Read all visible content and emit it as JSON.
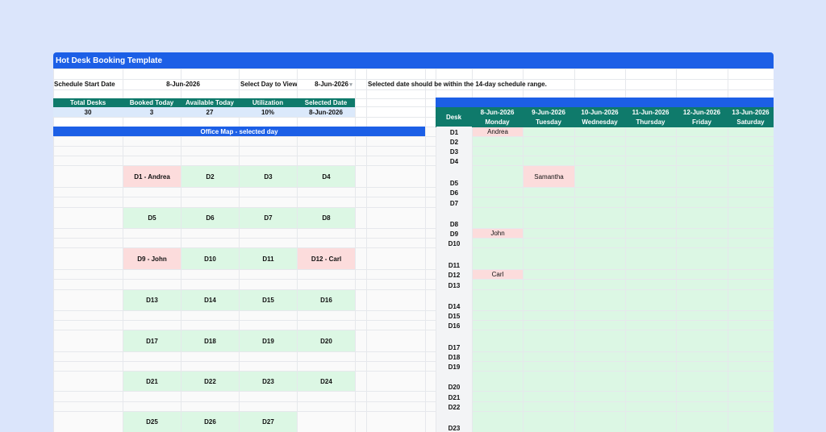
{
  "title": "Hot Desk Booking Template",
  "settings": {
    "start_label": "Schedule Start Date",
    "start_value": "8-Jun-2026",
    "day_label": "Select Day to View",
    "day_value": "8-Jun-2026",
    "note": "Selected date should be within the 14-day schedule range."
  },
  "stats": {
    "headers": [
      "Total Desks",
      "Booked Today",
      "Available Today",
      "Utilization",
      "Selected Date"
    ],
    "values": [
      "30",
      "3",
      "27",
      "10%",
      "8-Jun-2026"
    ]
  },
  "office_map": {
    "title": "Office Map - selected day",
    "rows": [
      [
        {
          "label": "D1 - Andrea",
          "booked": true
        },
        {
          "label": "D2",
          "booked": false
        },
        {
          "label": "D3",
          "booked": false
        },
        {
          "label": "D4",
          "booked": false
        }
      ],
      [
        {
          "label": "D5",
          "booked": false
        },
        {
          "label": "D6",
          "booked": false
        },
        {
          "label": "D7",
          "booked": false
        },
        {
          "label": "D8",
          "booked": false
        }
      ],
      [
        {
          "label": "D9 - John",
          "booked": true
        },
        {
          "label": "D10",
          "booked": false
        },
        {
          "label": "D11",
          "booked": false
        },
        {
          "label": "D12 - Carl",
          "booked": true
        }
      ],
      [
        {
          "label": "D13",
          "booked": false
        },
        {
          "label": "D14",
          "booked": false
        },
        {
          "label": "D15",
          "booked": false
        },
        {
          "label": "D16",
          "booked": false
        }
      ],
      [
        {
          "label": "D17",
          "booked": false
        },
        {
          "label": "D18",
          "booked": false
        },
        {
          "label": "D19",
          "booked": false
        },
        {
          "label": "D20",
          "booked": false
        }
      ],
      [
        {
          "label": "D21",
          "booked": false
        },
        {
          "label": "D22",
          "booked": false
        },
        {
          "label": "D23",
          "booked": false
        },
        {
          "label": "D24",
          "booked": false
        }
      ],
      [
        {
          "label": "D25",
          "booked": false
        },
        {
          "label": "D26",
          "booked": false
        },
        {
          "label": "D27",
          "booked": false
        }
      ]
    ]
  },
  "schedule": {
    "desk_header": "Desk",
    "days": [
      {
        "date": "8-Jun-2026",
        "weekday": "Monday"
      },
      {
        "date": "9-Jun-2026",
        "weekday": "Tuesday"
      },
      {
        "date": "10-Jun-2026",
        "weekday": "Wednesday"
      },
      {
        "date": "11-Jun-2026",
        "weekday": "Thursday"
      },
      {
        "date": "12-Jun-2026",
        "weekday": "Friday"
      },
      {
        "date": "13-Jun-2026",
        "weekday": "Saturday"
      }
    ],
    "desks": [
      {
        "desk": "D1",
        "bookings": [
          "Andrea",
          "",
          "",
          "",
          "",
          ""
        ]
      },
      {
        "desk": "D2",
        "bookings": [
          "",
          "",
          "",
          "",
          "",
          ""
        ]
      },
      {
        "desk": "D3",
        "bookings": [
          "",
          "",
          "",
          "",
          "",
          ""
        ]
      },
      {
        "desk": "D4",
        "bookings": [
          "",
          "",
          "",
          "",
          "",
          ""
        ]
      },
      {
        "desk": "D5",
        "bookings": [
          "",
          "Samantha",
          "",
          "",
          "",
          ""
        ]
      },
      {
        "desk": "D6",
        "bookings": [
          "",
          "",
          "",
          "",
          "",
          ""
        ]
      },
      {
        "desk": "D7",
        "bookings": [
          "",
          "",
          "",
          "",
          "",
          ""
        ]
      },
      {
        "desk": "D8",
        "bookings": [
          "",
          "",
          "",
          "",
          "",
          ""
        ]
      },
      {
        "desk": "D9",
        "bookings": [
          "John",
          "",
          "",
          "",
          "",
          ""
        ]
      },
      {
        "desk": "D10",
        "bookings": [
          "",
          "",
          "",
          "",
          "",
          ""
        ]
      },
      {
        "desk": "D11",
        "bookings": [
          "",
          "",
          "",
          "",
          "",
          ""
        ]
      },
      {
        "desk": "D12",
        "bookings": [
          "Carl",
          "",
          "",
          "",
          "",
          ""
        ]
      },
      {
        "desk": "D13",
        "bookings": [
          "",
          "",
          "",
          "",
          "",
          ""
        ]
      },
      {
        "desk": "D14",
        "bookings": [
          "",
          "",
          "",
          "",
          "",
          ""
        ]
      },
      {
        "desk": "D15",
        "bookings": [
          "",
          "",
          "",
          "",
          "",
          ""
        ]
      },
      {
        "desk": "D16",
        "bookings": [
          "",
          "",
          "",
          "",
          "",
          ""
        ]
      },
      {
        "desk": "D17",
        "bookings": [
          "",
          "",
          "",
          "",
          "",
          ""
        ]
      },
      {
        "desk": "D18",
        "bookings": [
          "",
          "",
          "",
          "",
          "",
          ""
        ]
      },
      {
        "desk": "D19",
        "bookings": [
          "",
          "",
          "",
          "",
          "",
          ""
        ]
      },
      {
        "desk": "D20",
        "bookings": [
          "",
          "",
          "",
          "",
          "",
          ""
        ]
      },
      {
        "desk": "D21",
        "bookings": [
          "",
          "",
          "",
          "",
          "",
          ""
        ]
      },
      {
        "desk": "D22",
        "bookings": [
          "",
          "",
          "",
          "",
          "",
          ""
        ]
      },
      {
        "desk": "D23",
        "bookings": [
          "",
          "",
          "",
          "",
          "",
          ""
        ]
      }
    ]
  },
  "colors": {
    "title_blue": "#1c5fe6",
    "header_teal": "#0f7a6b",
    "stats_values_bg": "#dbe9fb",
    "available_green": "#dcf7e4",
    "booked_pink": "#fcdcdc",
    "page_bg": "#dbe5fb"
  },
  "icons": {
    "day_dropdown": "chevron-down-icon"
  }
}
